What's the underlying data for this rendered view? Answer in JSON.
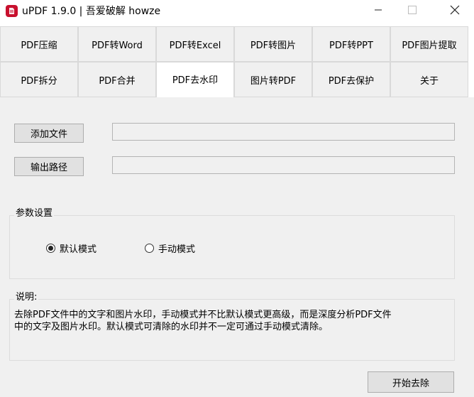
{
  "window": {
    "title": "uPDF 1.9.0 | 吾爱破解 howze"
  },
  "tabs_row1": [
    {
      "label": "PDF压缩"
    },
    {
      "label": "PDF转Word"
    },
    {
      "label": "PDF转Excel"
    },
    {
      "label": "PDF转图片"
    },
    {
      "label": "PDF转PPT"
    },
    {
      "label": "PDF图片提取"
    }
  ],
  "tabs_row2": [
    {
      "label": "PDF拆分"
    },
    {
      "label": "PDF合并"
    },
    {
      "label": "PDF去水印"
    },
    {
      "label": "图片转PDF"
    },
    {
      "label": "PDF去保护"
    },
    {
      "label": "关于"
    }
  ],
  "active_tab": "PDF去水印",
  "files": {
    "add_file_label": "添加文件",
    "add_file_value": "",
    "output_path_label": "输出路径",
    "output_path_value": ""
  },
  "settings": {
    "group_label": "参数设置",
    "default_mode_label": "默认模式",
    "manual_mode_label": "手动模式",
    "selected_mode": "默认模式"
  },
  "description": {
    "group_label": "说明:",
    "text": "去除PDF文件中的文字和图片水印，手动模式并不比默认模式更高级，而是深度分析PDF文件\n中的文字及图片水印。默认模式可清除的水印并不一定可通过手动模式清除。"
  },
  "actions": {
    "start_label": "开始去除"
  },
  "colors": {
    "app_icon": "#c8102e",
    "panel_bg": "#f0f0f0",
    "tab_bg": "#f0f0f0",
    "active_tab_bg": "#ffffff",
    "button_bg": "#e1e1e1"
  },
  "icons": {
    "app": "updf-app-icon",
    "minimize": "minimize-icon",
    "maximize": "maximize-icon",
    "close": "close-icon"
  }
}
